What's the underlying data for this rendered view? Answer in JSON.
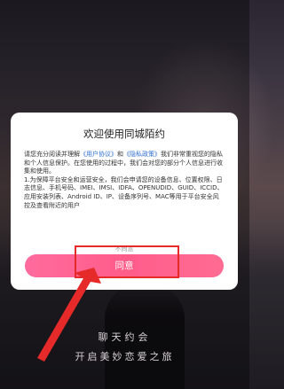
{
  "dialog": {
    "title": "欢迎使用同城陌约",
    "paragraph1": {
      "prefix": "请您充分阅读并理解",
      "link1": "《用户协议》",
      "joiner": "和",
      "link2": "《隐私政策》",
      "suffix": "我们非常重视您的隐私和个人信息保护。在您使用的过程中，我们会对您的部分个人信息进行收集和使用。"
    },
    "paragraph2": "1.为保障平台安全和运营安全，我们会申请您的设备信息、位置权限、日志信息、手机号码、IMEI、IMSI、IDFA、OPENUDID、GUID、ICCID、应用安装列表、Android ID、IP、设备序列号、MAC等用于平台安全风控及查看附近的用户",
    "disagree_label": "不同意",
    "agree_label": "同意"
  },
  "background": {
    "tagline_line1": "聊天约会",
    "tagline_line2": "开启美妙恋爱之旅"
  },
  "colors": {
    "accent": "#ff5d8a",
    "link": "#2f6fd1",
    "annotation": "#e62a2a"
  }
}
